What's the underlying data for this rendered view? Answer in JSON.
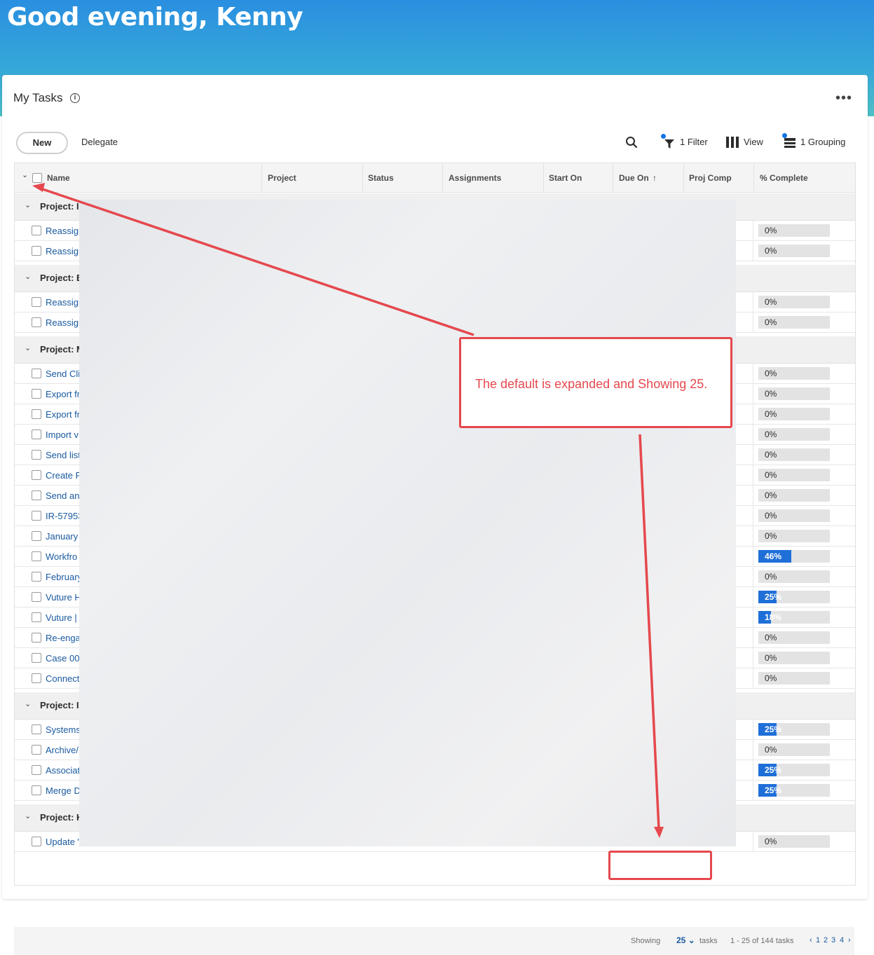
{
  "greeting": "Good evening, Kenny",
  "card": {
    "title": "My Tasks",
    "more_label": "•••"
  },
  "toolbar": {
    "new_label": "New",
    "delegate_label": "Delegate",
    "filter_label": "1 Filter",
    "view_label": "View",
    "grouping_label": "1 Grouping"
  },
  "columns": {
    "name": "Name",
    "project": "Project",
    "status": "Status",
    "assignments": "Assignments",
    "start_on": "Start On",
    "due_on": "Due On",
    "proj_comp": "Proj Comp",
    "pct_complete": "% Complete"
  },
  "groups": [
    {
      "label": "Project: I"
    },
    {
      "label": "Project: E"
    },
    {
      "label": "Project: M"
    },
    {
      "label": "Project: Ir"
    },
    {
      "label": "Project: K"
    }
  ],
  "tasks": [
    {
      "name": "Reassign",
      "pct": "0%",
      "fill": 0
    },
    {
      "name": "Reassign",
      "pct": "0%",
      "fill": 0
    },
    {
      "name": "Reassign",
      "pct": "0%",
      "fill": 0
    },
    {
      "name": "Reassign",
      "pct": "0%",
      "fill": 0
    },
    {
      "name": "Send Cli",
      "pct": "0%",
      "fill": 0
    },
    {
      "name": "Export fr",
      "pct": "0%",
      "fill": 0
    },
    {
      "name": "Export fr",
      "pct": "0%",
      "fill": 0
    },
    {
      "name": "Import v",
      "pct": "0%",
      "fill": 0
    },
    {
      "name": "Send list",
      "pct": "0%",
      "fill": 0
    },
    {
      "name": "Create P",
      "pct": "0%",
      "fill": 0
    },
    {
      "name": "Send an",
      "pct": "0%",
      "fill": 0
    },
    {
      "name": "IR-57953",
      "pct": "0%",
      "fill": 0
    },
    {
      "name": "January",
      "pct": "0%",
      "fill": 0
    },
    {
      "name": "Workfro",
      "pct": "46%",
      "fill": 0.46
    },
    {
      "name": "February",
      "pct": "0%",
      "fill": 0
    },
    {
      "name": "Vuture H",
      "pct": "25%",
      "fill": 0.25
    },
    {
      "name": "Vuture |",
      "pct": "18%",
      "fill": 0.18
    },
    {
      "name": "Re-enga",
      "pct": "0%",
      "fill": 0
    },
    {
      "name": "Case 00",
      "pct": "0%",
      "fill": 0
    },
    {
      "name": "Connect",
      "pct": "0%",
      "fill": 0
    },
    {
      "name": "Systems",
      "pct": "25%",
      "fill": 0.25
    },
    {
      "name": "Archive/",
      "pct": "0%",
      "fill": 0
    },
    {
      "name": "Associat",
      "pct": "25%",
      "fill": 0.25
    },
    {
      "name": "Merge D",
      "pct": "25%",
      "fill": 0.25
    },
    {
      "name": "Update \"",
      "pct": "0%",
      "fill": 0
    }
  ],
  "footer": {
    "showing_label": "Showing",
    "page_size": "25",
    "tasks_label": "tasks",
    "range_label": "1 - 25 of 144 tasks",
    "pages": [
      "1",
      "2",
      "3",
      "4"
    ]
  },
  "annotation": {
    "callout_text": "The default is expanded and Showing 25."
  },
  "colors": {
    "accent": "#1473e6",
    "progress": "#1f6fd8",
    "annotation": "#e5484d"
  }
}
